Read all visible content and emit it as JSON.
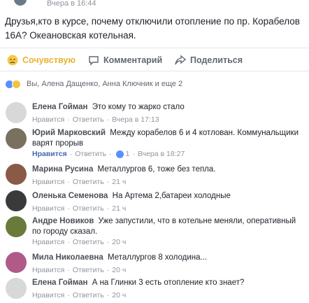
{
  "post": {
    "time": "Вчера в 16:44",
    "text": "Друзья,кто в курсе, почему отключили отопление по пр. Корабелов 16А? Океановская котельная."
  },
  "actions": {
    "like": "Сочувствую",
    "comment": "Комментарий",
    "share": "Поделиться"
  },
  "reactions": {
    "text": "Вы, Алена Дащенко, Анна Ключник и еще 2"
  },
  "comments": [
    {
      "author": "Елена Гойман",
      "text": "Это кому то жарко стало",
      "like": "Нравится",
      "reply": "Ответить",
      "time": "Вчера в 17:13",
      "avatar_color": "#d8d8d8"
    },
    {
      "author": "Юрий Марковский",
      "text": "Между корабелов 6 и 4 котлован. Коммунальщики варят прорыв",
      "like": "Нравится",
      "reply": "Ответить",
      "count": "1",
      "time": "Вчера в 18:27",
      "avatar_color": "#7a7060"
    },
    {
      "author": "Марина Русина",
      "text": "Металлургов 6, тоже без тепла.",
      "like": "Нравится",
      "reply": "Ответить",
      "time": "21 ч",
      "avatar_color": "#8a5a48"
    },
    {
      "author": "Оленька Семенова",
      "text": "На Артема 2,батареи холодные",
      "like": "Нравится",
      "reply": "Ответить",
      "time": "21 ч",
      "avatar_color": "#3a3a3a"
    },
    {
      "author": "Андре Новиков",
      "text": "Уже запустили, что в котельне меняли, оперативный по городу сказал.",
      "like": "Нравится",
      "reply": "Ответить",
      "time": "20 ч",
      "avatar_color": "#6a7a3a"
    },
    {
      "author": "Мила Николаевна",
      "text": "Металлургов 8 холодина...",
      "like": "Нравится",
      "reply": "Ответить",
      "time": "20 ч",
      "avatar_color": "#b05a8a"
    },
    {
      "author": "Елена Гойман",
      "text": "А на Глинки 3 есть отопление кто знает?",
      "like": "Нравится",
      "reply": "Ответить",
      "time": "20 ч",
      "avatar_color": "#d8d8d8"
    }
  ]
}
